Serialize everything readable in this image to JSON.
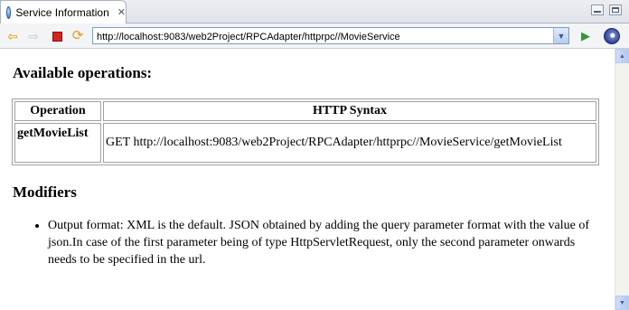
{
  "tab": {
    "title": "Service Information",
    "close_glyph": "✕"
  },
  "toolbar": {
    "url": "http://localhost:9083/web2Project/RPCAdapter/httprpc//MovieService"
  },
  "page": {
    "heading_operations": "Available operations:",
    "table": {
      "headers": [
        "Operation",
        "HTTP Syntax"
      ],
      "rows": [
        {
          "operation": "getMovieList",
          "syntax": "GET http://localhost:9083/web2Project/RPCAdapter/httprpc//MovieService/getMovieList"
        }
      ]
    },
    "heading_modifiers": "Modifiers",
    "modifiers": [
      "Output format: XML is the default. JSON obtained by adding the query parameter format with the value of json.In case of the first parameter being of type HttpServletRequest, only the second parameter onwards needs to be specified in the url."
    ]
  },
  "icons": [
    "service-info-icon",
    "tab-close-icon",
    "minimize-icon",
    "maximize-icon",
    "back-arrow-icon",
    "forward-arrow-icon",
    "stop-icon",
    "refresh-icon",
    "dropdown-chevron-icon",
    "go-icon",
    "eclipse-icon",
    "scroll-up-icon",
    "scroll-down-icon"
  ],
  "colors": {
    "stop": "#d8241f",
    "go": "#2e9a2e",
    "nav_arrow": "#e39b1a",
    "border": "#a0a0a0"
  }
}
